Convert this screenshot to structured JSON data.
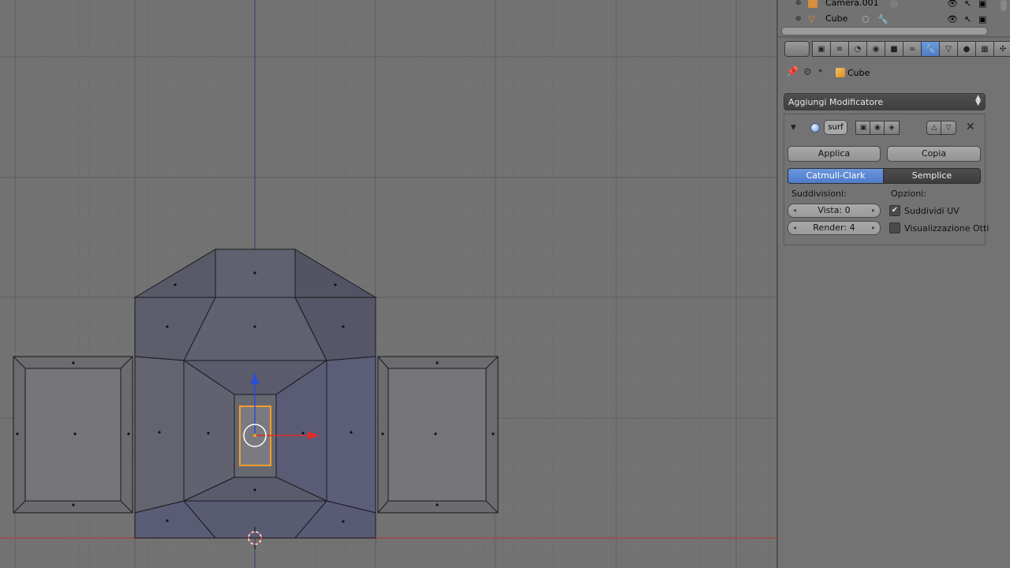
{
  "outliner": {
    "items": [
      {
        "name": "Camera.001",
        "icon": "camera-icon"
      },
      {
        "name": "Cube",
        "icon": "mesh-icon"
      }
    ]
  },
  "properties": {
    "breadcrumb_object": "Cube",
    "add_modifier_label": "Aggiungi Modificatore",
    "modifier": {
      "name": "surf",
      "apply_label": "Applica",
      "copy_label": "Copia",
      "mode_options": [
        "Catmull-Clark",
        "Semplice"
      ],
      "active_mode": "Catmull-Clark",
      "subdivisions_label": "Suddivisioni:",
      "options_label": "Opzioni:",
      "view_field": "Vista: 0",
      "render_field": "Render: 4",
      "subdivide_uv_label": "Suddividi UV",
      "subdivide_uv_checked": true,
      "optimal_display_label": "Visualizzazione Otti",
      "optimal_display_checked": false
    }
  },
  "colors": {
    "viewport_bg": "#727272",
    "face": "#5b5c6c",
    "selected_face_outline": "#f59d2a",
    "active_tab": "#5680c2"
  }
}
